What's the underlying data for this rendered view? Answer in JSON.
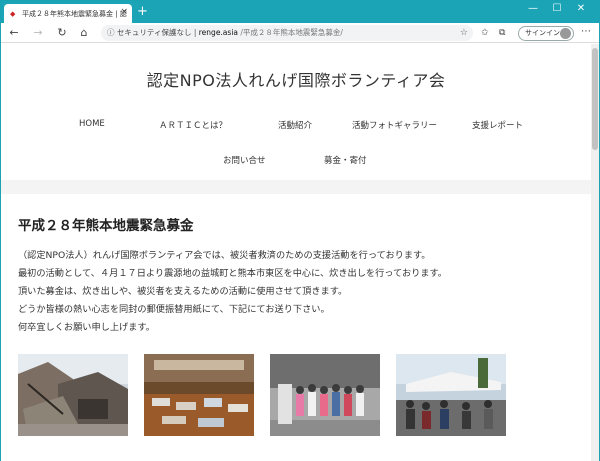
{
  "browser": {
    "tab_title": "平成２８年熊本地震緊急募金 | 認",
    "tab_close": "×",
    "new_tab": "+",
    "win_min": "—",
    "win_max": "☐",
    "win_close": "✕",
    "address": {
      "security": "セキュリティ保護なし",
      "separator": " | ",
      "host": "renge.asia",
      "path": "/平成２８年熊本地震緊急募金/"
    },
    "sign_in": "サインイン"
  },
  "site": {
    "title": "認定NPO法人れんげ国際ボランティア会",
    "nav": {
      "home": "HOME",
      "artic": "ＡＲＴＩＣとは？",
      "activities": "活動紹介",
      "photo_gallery": "活動フォトギャラリー",
      "reports": "支援レポート",
      "contact": "お問い合せ",
      "donation": "募金・寄付"
    }
  },
  "post": {
    "title": "平成２８年熊本地震緊急募金",
    "paragraphs": [
      "（認定NPO法人）れんげ国際ボランティア会では、被災者救済のための支援活動を行っております。",
      "最初の活動として、４月１７日より震源地の益城町と熊本市東区を中心に、炊き出しを行っております。",
      "頂いた募金は、炊き出しや、被災者を支えるための活動に使用させて頂きます。",
      "どうか皆様の熱い心志を同封の郵便振替用紙にて、下記にてお送り下さい。",
      "何卒宜しくお願い申し上げます。"
    ]
  },
  "colors": {
    "chrome_accent": "#1ba4b6",
    "text": "#333333"
  }
}
